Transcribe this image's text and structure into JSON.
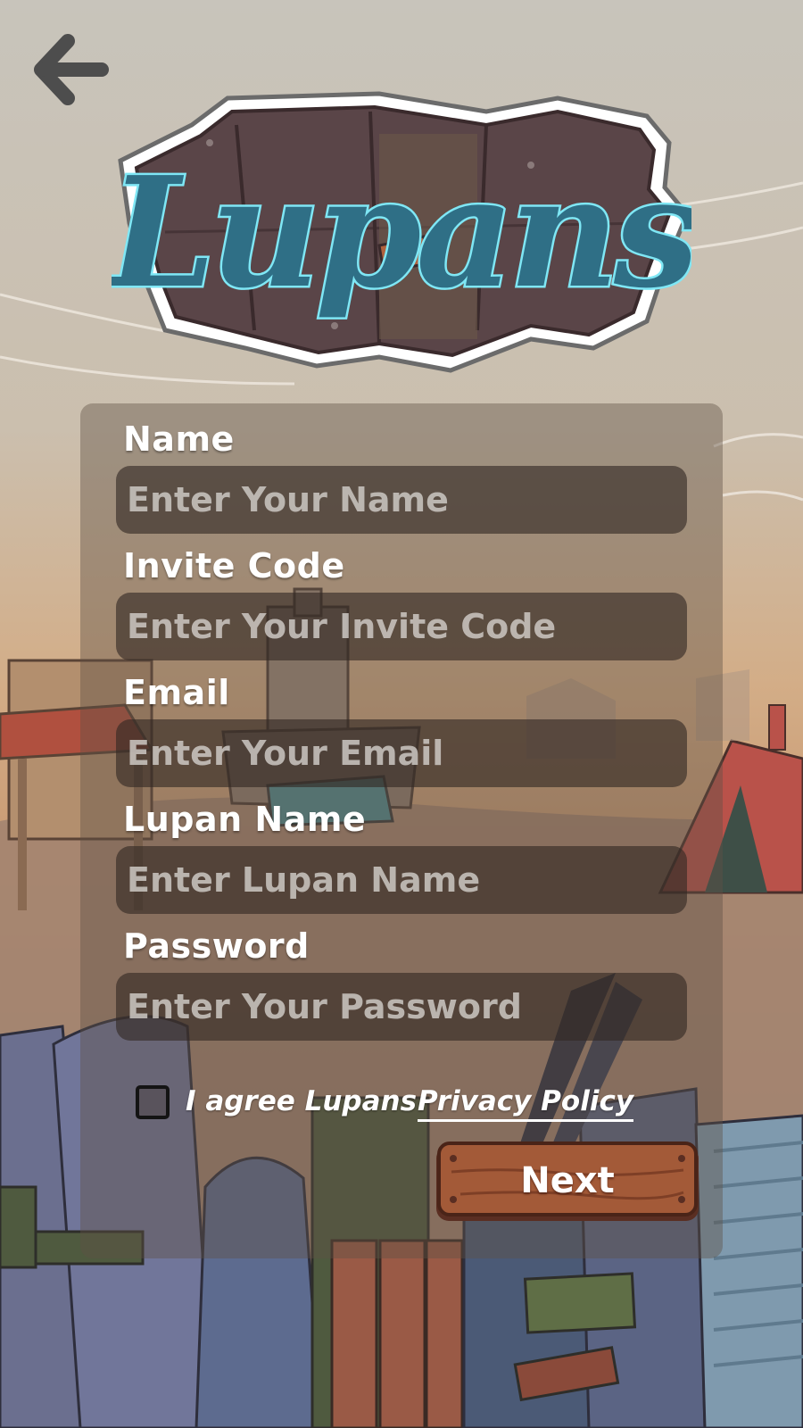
{
  "app": {
    "logo_text": "Lupans"
  },
  "form": {
    "fields": [
      {
        "label": "Name",
        "placeholder": "Enter Your Name",
        "value": ""
      },
      {
        "label": "Invite Code",
        "placeholder": "Enter Your Invite Code",
        "value": ""
      },
      {
        "label": "Email",
        "placeholder": "Enter Your Email",
        "value": ""
      },
      {
        "label": "Lupan Name",
        "placeholder": "Enter Lupan Name",
        "value": ""
      },
      {
        "label": "Password",
        "placeholder": "Enter Your Password",
        "value": ""
      }
    ],
    "agree_text": "I agree Lupans",
    "privacy_link": "Privacy Policy",
    "agree_checked": false,
    "next_label": "Next"
  },
  "icons": {
    "back": "arrow-left-icon",
    "checkbox": "checkbox-icon"
  },
  "colors": {
    "logo_letters": "#2f6f86",
    "logo_outline": "#7fe7f5",
    "button_wood": "#9a5636",
    "panel": "#5f5046"
  }
}
